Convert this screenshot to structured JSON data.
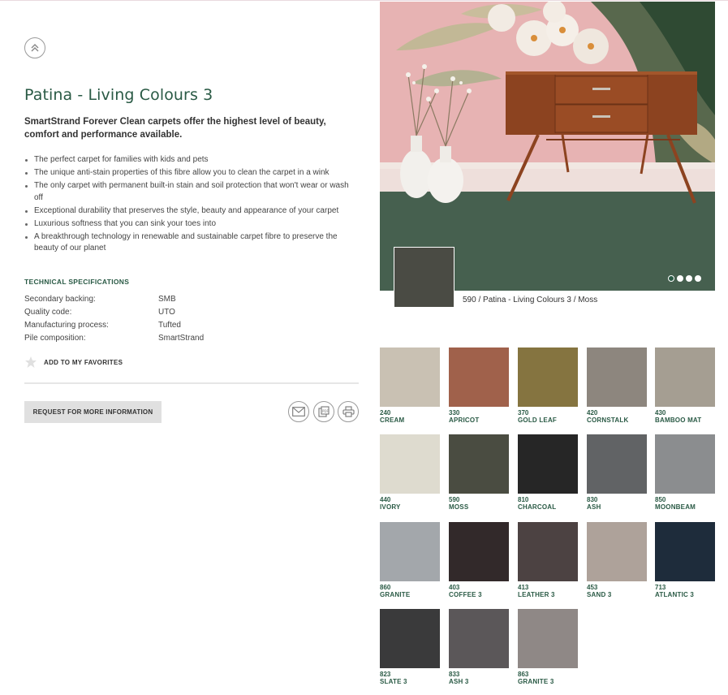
{
  "product": {
    "title": "Patina - Living Colours 3",
    "intro": "SmartStrand Forever Clean carpets offer the highest level of beauty, comfort and performance available.",
    "features": [
      "The perfect carpet for families with kids and pets",
      "The unique anti-stain properties of this fibre allow you to clean the carpet in a wink",
      "The only carpet with permanent built-in stain and soil protection that won't wear or wash off",
      "Exceptional durability that preserves the style, beauty and appearance of your carpet",
      "Luxurious softness that you can sink your toes into",
      "A breakthrough technology in renewable and sustainable carpet fibre to preserve the beauty of our planet"
    ]
  },
  "specs": {
    "heading": "TECHNICAL SPECIFICATIONS",
    "rows": [
      {
        "label": "Secondary backing:",
        "value": "SMB"
      },
      {
        "label": "Quality code:",
        "value": "UTO"
      },
      {
        "label": "Manufacturing process:",
        "value": "Tufted"
      },
      {
        "label": "Pile composition:",
        "value": "SmartStrand"
      }
    ]
  },
  "actions": {
    "favorites_label": "ADD TO MY FAVORITES",
    "request_label": "REQUEST FOR MORE INFORMATION",
    "icons": [
      "chevron-up-double-icon",
      "email-icon",
      "pdf-icon",
      "print-icon",
      "star-icon"
    ]
  },
  "gallery": {
    "caption": "590 / Patina - Living Colours 3 / Moss",
    "slides_total": 4,
    "active_slide": 1
  },
  "swatches": [
    {
      "code": "240",
      "name": "CREAM",
      "color": "#c9c1b3"
    },
    {
      "code": "330",
      "name": "APRICOT",
      "color": "#a0614b"
    },
    {
      "code": "370",
      "name": "GOLD LEAF",
      "color": "#857440"
    },
    {
      "code": "420",
      "name": "CORNSTALK",
      "color": "#8d867e"
    },
    {
      "code": "430",
      "name": "BAMBOO MAT",
      "color": "#a59e92"
    },
    {
      "code": "440",
      "name": "IVORY",
      "color": "#dedbcf"
    },
    {
      "code": "590",
      "name": "MOSS",
      "color": "#4a4c41"
    },
    {
      "code": "810",
      "name": "CHARCOAL",
      "color": "#262626"
    },
    {
      "code": "830",
      "name": "ASH",
      "color": "#616365"
    },
    {
      "code": "850",
      "name": "MOONBEAM",
      "color": "#8b8d8f"
    },
    {
      "code": "860",
      "name": "GRANITE",
      "color": "#a3a7ab"
    },
    {
      "code": "403",
      "name": "COFFEE 3",
      "color": "#32292a"
    },
    {
      "code": "413",
      "name": "LEATHER 3",
      "color": "#4c4242"
    },
    {
      "code": "453",
      "name": "SAND 3",
      "color": "#aea29a"
    },
    {
      "code": "713",
      "name": "ATLANTIC 3",
      "color": "#1e2c3b"
    },
    {
      "code": "823",
      "name": "SLATE 3",
      "color": "#3a3a3b"
    },
    {
      "code": "833",
      "name": "ASH 3",
      "color": "#5b5759"
    },
    {
      "code": "863",
      "name": "GRANITE 3",
      "color": "#8f8886"
    }
  ],
  "colors": {
    "accent": "#2a5a45",
    "button_bg": "#e0e0e0"
  }
}
